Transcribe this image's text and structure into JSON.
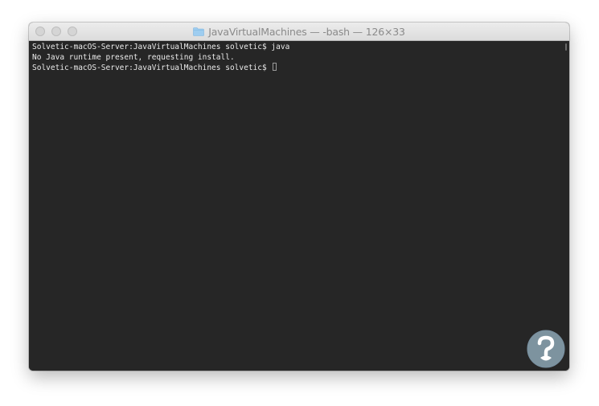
{
  "window": {
    "title": "JavaVirtualMachines — -bash — 126×33"
  },
  "terminal": {
    "lines": [
      "Solvetic-macOS-Server:JavaVirtualMachines solvetic$ java",
      "No Java runtime present, requesting install.",
      "Solvetic-macOS-Server:JavaVirtualMachines solvetic$ "
    ]
  },
  "icons": {
    "title_icon": "folder-icon",
    "traffic_lights": [
      "close-icon",
      "minimize-icon",
      "zoom-icon"
    ],
    "watermark": "solvetic-logo"
  },
  "colors": {
    "terminal_bg": "#262626",
    "terminal_fg": "#eaeaea",
    "folder": "#9ecdf0",
    "watermark": "#8da7b5"
  }
}
